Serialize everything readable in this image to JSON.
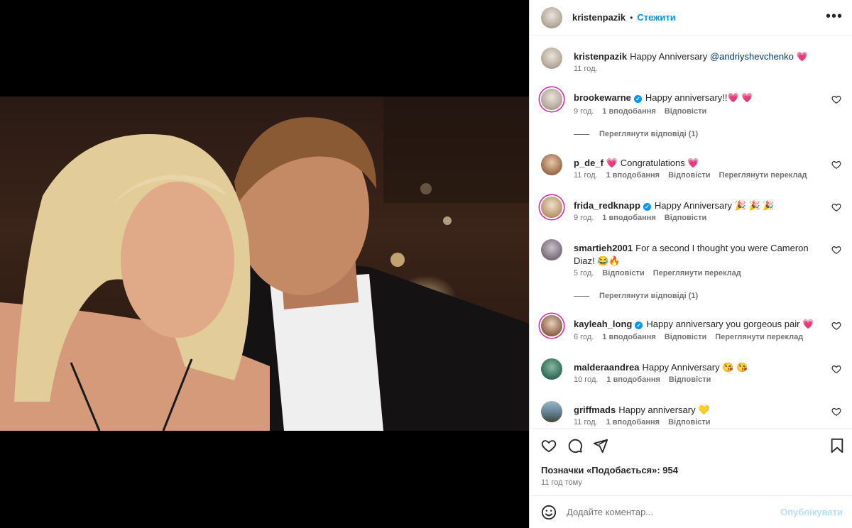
{
  "post": {
    "username": "kristenpazik",
    "follow_label": "Стежити",
    "more_label": "•••"
  },
  "caption": {
    "username": "kristenpazik",
    "text": "Happy Anniversary ",
    "mention": "@andriyshevchenko",
    "emoji": "💗",
    "time": "11 год."
  },
  "comments": [
    {
      "username": "brookewarne",
      "verified": true,
      "text": "Happy anniversary!!💗 💗",
      "time": "9 год.",
      "likes": "1 вподобання",
      "reply": "Відповісти",
      "translate": "",
      "view_replies": "Переглянути відповіді (1)"
    },
    {
      "username": "p_de_f",
      "verified": false,
      "text": "💗 Congratulations 💗",
      "time": "11 год.",
      "likes": "1 вподобання",
      "reply": "Відповісти",
      "translate": "Переглянути переклад",
      "view_replies": ""
    },
    {
      "username": "frida_redknapp",
      "verified": true,
      "text": "Happy Anniversary 🎉 🎉 🎉",
      "time": "9 год.",
      "likes": "1 вподобання",
      "reply": "Відповісти",
      "translate": "",
      "view_replies": ""
    },
    {
      "username": "smartieh2001",
      "verified": false,
      "text": "For a second I thought you were Cameron Diaz! 😂🔥",
      "time": "5 год.",
      "likes": "",
      "reply": "Відповісти",
      "translate": "Переглянути переклад",
      "view_replies": "Переглянути відповіді (1)"
    },
    {
      "username": "kayleah_long",
      "verified": true,
      "text": "Happy anniversary you gorgeous pair 💗",
      "time": "6 год.",
      "likes": "1 вподобання",
      "reply": "Відповісти",
      "translate": "Переглянути переклад",
      "view_replies": ""
    },
    {
      "username": "malderaandrea",
      "verified": false,
      "text": "Happy Anniversary 😘 😘",
      "time": "10 год.",
      "likes": "1 вподобання",
      "reply": "Відповісти",
      "translate": "",
      "view_replies": ""
    },
    {
      "username": "griffmads",
      "verified": false,
      "text": "Happy anniversary 💛",
      "time": "11 год.",
      "likes": "1 вподобання",
      "reply": "Відповісти",
      "translate": "",
      "view_replies": ""
    }
  ],
  "footer": {
    "likes_text": "Позначки «Подобається»: 954",
    "time_text": "11 год тому",
    "comment_placeholder": "Додайте коментар...",
    "post_label": "Опублікувати"
  },
  "colors": {
    "accent": "#0095f6",
    "muted": "#737373",
    "mention": "#00376b"
  },
  "icons": [
    "more-icon",
    "heart-icon",
    "comment-icon",
    "share-icon",
    "bookmark-icon",
    "smile-icon",
    "verified-badge"
  ]
}
